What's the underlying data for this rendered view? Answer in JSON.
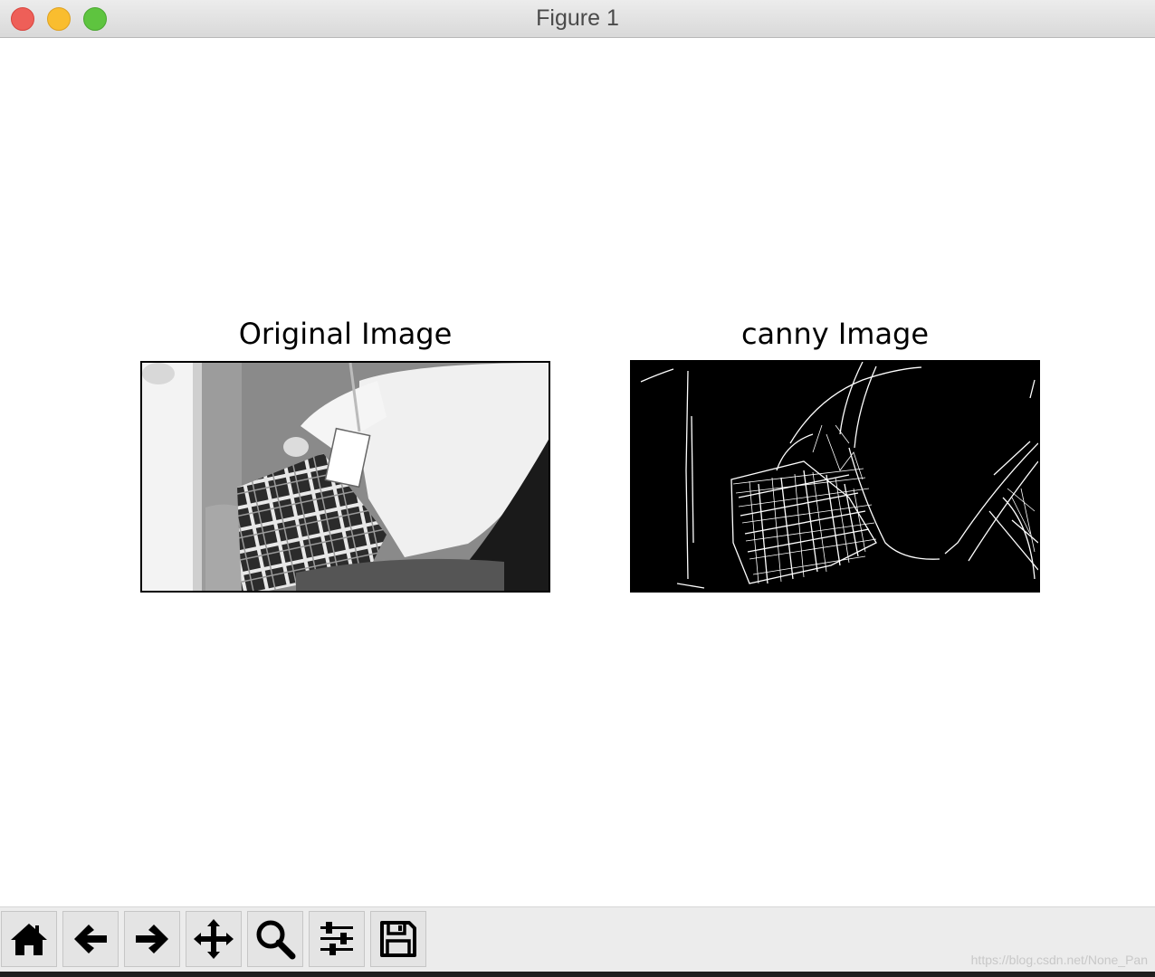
{
  "window": {
    "title": "Figure 1"
  },
  "axes": [
    {
      "title": "Original Image",
      "cmap": "gray"
    },
    {
      "title": "canny Image",
      "cmap": "gray"
    }
  ],
  "toolbar": {
    "buttons": [
      {
        "icon": "home-icon",
        "name": "home-button"
      },
      {
        "icon": "back-arrow-icon",
        "name": "back-button"
      },
      {
        "icon": "forward-arrow-icon",
        "name": "forward-button"
      },
      {
        "icon": "pan-move-icon",
        "name": "pan-button"
      },
      {
        "icon": "zoom-magnifier-icon",
        "name": "zoom-button"
      },
      {
        "icon": "sliders-configure-icon",
        "name": "configure-subplots-button"
      },
      {
        "icon": "floppy-save-icon",
        "name": "save-button"
      }
    ]
  },
  "watermark": "https://blog.csdn.net/None_Pan",
  "colors": {
    "canvas": "#ffffff",
    "toolbar": "#ececec",
    "edge_line": "#ffffff",
    "edge_bg": "#000000"
  }
}
